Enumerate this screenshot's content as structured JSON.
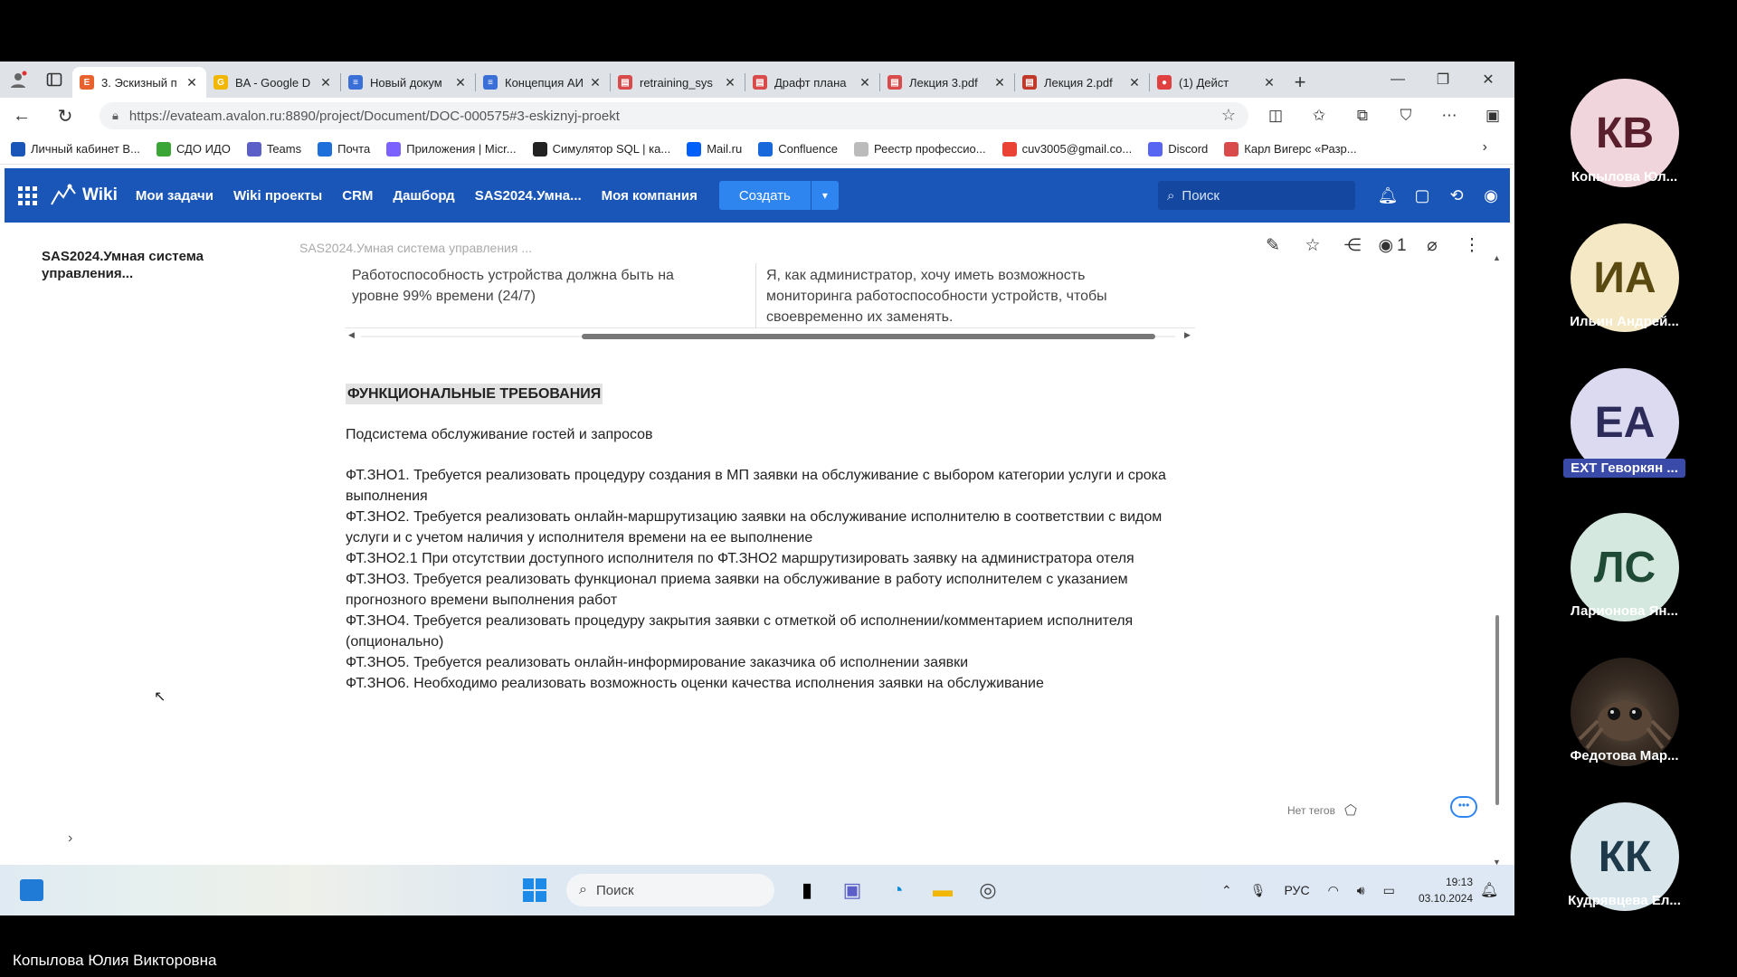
{
  "browser": {
    "tabs": [
      {
        "label": "3. Эскизный п",
        "color": "#e8622d",
        "icon": "E",
        "active": true
      },
      {
        "label": "BA - Google D",
        "color": "#f2b705",
        "icon": "G",
        "active": false
      },
      {
        "label": "Новый докум",
        "color": "#3a6fd8",
        "icon": "≡",
        "active": false
      },
      {
        "label": "Концепция АИ",
        "color": "#3a6fd8",
        "icon": "≡",
        "active": false
      },
      {
        "label": "retraining_sys",
        "color": "#d94a4a",
        "icon": "▤",
        "active": false
      },
      {
        "label": "Драфт плана",
        "color": "#d94a4a",
        "icon": "▤",
        "active": false
      },
      {
        "label": "Лекция 3.pdf",
        "color": "#d94a4a",
        "icon": "▤",
        "active": false
      },
      {
        "label": "Лекция 2.pdf",
        "color": "#c0392b",
        "icon": "▤",
        "active": false
      },
      {
        "label": "(1) Дейст",
        "color": "#e04040",
        "icon": "●",
        "active": false
      }
    ],
    "new_tab": "+",
    "url": "https://evateam.avalon.ru:8890/project/Document/DOC-000575#3-eskiznyj-proekt",
    "bookmarks": [
      {
        "label": "Личный кабинет В...",
        "color": "#1a56b8"
      },
      {
        "label": "СДО ИДО",
        "color": "#3aa635"
      },
      {
        "label": "Teams",
        "color": "#5b5fc7"
      },
      {
        "label": "Почта",
        "color": "#1e6fd9"
      },
      {
        "label": "Приложения | Micr...",
        "color": "#7b61ff"
      },
      {
        "label": "Симулятор SQL | ка...",
        "color": "#222222"
      },
      {
        "label": "Mail.ru",
        "color": "#005ff9"
      },
      {
        "label": "Confluence",
        "color": "#1868db"
      },
      {
        "label": "Реестр профессио...",
        "color": "#bbbbbb"
      },
      {
        "label": "cuv3005@gmail.co...",
        "color": "#ea4335"
      },
      {
        "label": "Discord",
        "color": "#5865f2"
      },
      {
        "label": "Карл Вигерс «Разр...",
        "color": "#d94a4a"
      }
    ]
  },
  "app": {
    "logo": "Wiki",
    "nav": [
      "Мои задачи",
      "Wiki проекты",
      "CRM",
      "Дашборд",
      "SAS2024.Умна...",
      "Моя компания"
    ],
    "create_label": "Создать",
    "search_placeholder": "Поиск",
    "accent": "#1a56b8"
  },
  "doc": {
    "sidebar_title": "SAS2024.Умная система управления...",
    "breadcrumb": "SAS2024.Умная система управления ...",
    "views": "1",
    "table_cell_left": "Работоспособность устройства должна быть на уровне 99% времени (24/7)",
    "table_cell_right": "Я, как администратор, хочу иметь возможность мониторинга работоспособности устройств, чтобы своевременно их заменять.",
    "heading": "ФУНКЦИОНАЛЬНЫЕ ТРЕБОВАНИЯ",
    "subsystem": "Подсистема обслуживание гостей и запросов",
    "requirements": [
      "ФТ.ЗНО1. Требуется реализовать процедуру создания в МП заявки на обслуживание с выбором категории услуги и срока выполнения",
      "ФТ.ЗНО2. Требуется реализовать онлайн-маршрутизацию заявки на обслуживание исполнителю в соответствии с видом услуги и с учетом наличия у исполнителя времени на ее выполнение",
      "ФТ.ЗНО2.1 При отсутствии доступного исполнителя по ФТ.ЗНО2 маршрутизировать заявку на администратора отеля",
      "ФТ.ЗНО3. Требуется реализовать функционал приема заявки на обслуживание в работу исполнителем с указанием прогнозного времени выполнения работ",
      "ФТ.ЗНО4. Требуется реализовать процедуру закрытия заявки с отметкой об исполнении/комментарием исполнителя (опционально)",
      "ФТ.ЗНО5. Требуется реализовать онлайн-информирование заказчика об исполнении заявки",
      "ФТ.ЗНО6. Необходимо реализовать возможность оценки качества исполнения заявки на обслуживание"
    ],
    "tags_label": "Нет тегов"
  },
  "taskbar": {
    "search": "Поиск",
    "lang": "РУС",
    "time": "19:13",
    "date": "03.10.2024"
  },
  "participants": [
    {
      "initials": "КВ",
      "name": "Копылова Юл...",
      "bg": "#f0d6dc",
      "fg": "#5a1f2d",
      "boxed": false
    },
    {
      "initials": "ИА",
      "name": "Ильин Андрей...",
      "bg": "#f5e8c4",
      "fg": "#5a4a12",
      "boxed": false
    },
    {
      "initials": "ЕА",
      "name": "EXT Геворкян ...",
      "bg": "#dcdaf0",
      "fg": "#2d2b5a",
      "boxed": true
    },
    {
      "initials": "ЛС",
      "name": "Ларионова Ян...",
      "bg": "#d5e8df",
      "fg": "#1e4a36",
      "boxed": false
    },
    {
      "initials": "",
      "name": "Федотова Мар...",
      "bg": "#3b2f26",
      "fg": "#ffffff",
      "boxed": false
    },
    {
      "initials": "КК",
      "name": "Кудрявцева Ел...",
      "bg": "#d8e6ec",
      "fg": "#1e3a4a",
      "boxed": false
    }
  ],
  "speaker": "Копылова Юлия Викторовна"
}
